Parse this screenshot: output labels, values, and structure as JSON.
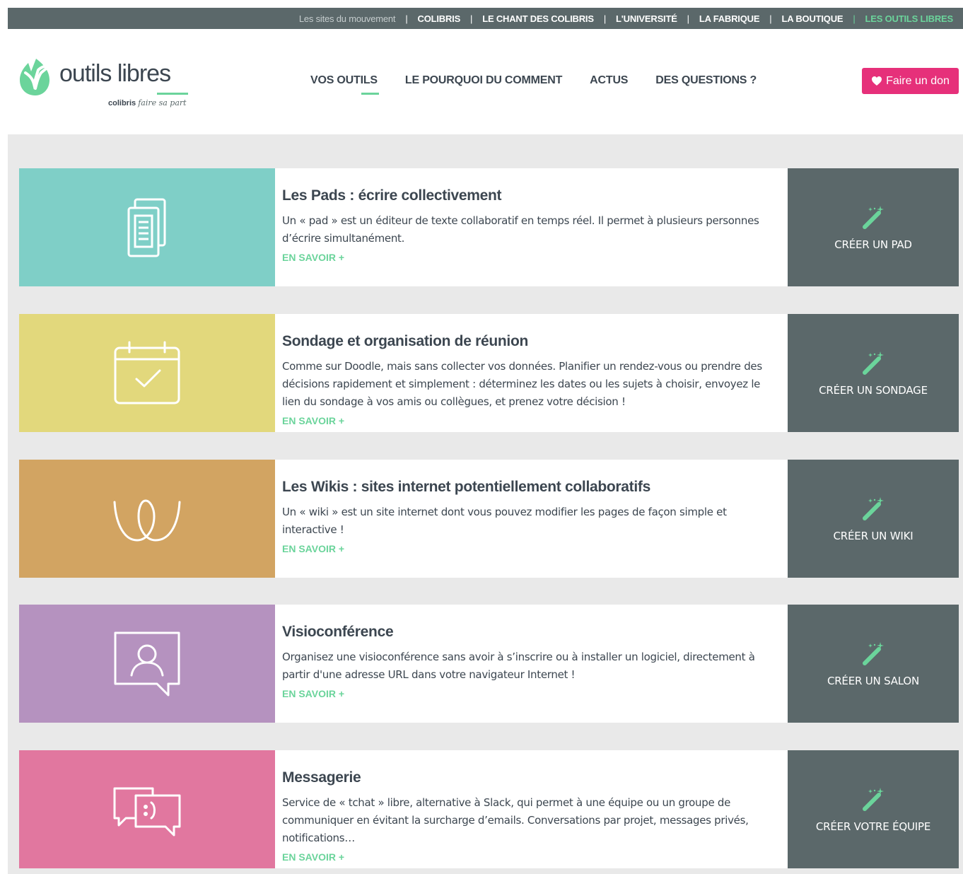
{
  "topbar": {
    "intro": "Les sites du mouvement",
    "links": [
      "COLIBRIS",
      "LE CHANT DES COLIBRIS",
      "L'UNIVERSITÉ",
      "LA FABRIQUE",
      "LA BOUTIQUE",
      "LES OUTILS LIBRES"
    ]
  },
  "header": {
    "logo_title": "outils libres",
    "logo_brand": "colibris",
    "logo_tagline": "faire sa part",
    "nav": [
      "VOS OUTILS",
      "LE POURQUOI DU COMMENT",
      "ACTUS",
      "DES QUESTIONS ?"
    ],
    "donate_label": "Faire un don"
  },
  "colors": {
    "accent": "#6bd49b",
    "donate": "#e6307a",
    "dark": "#5b686a",
    "pads": "#7fcfc7",
    "sondage": "#e2d87c",
    "wikis": "#d2a462",
    "visio": "#b592bf",
    "messagerie": "#e1779f"
  },
  "tools": [
    {
      "id": "pads",
      "icon": "document-icon",
      "title": "Les Pads : écrire collectivement",
      "description": "Un « pad » est un éditeur de texte collaboratif en temps réel. Il permet à plusieurs personnes d’écrire simultanément.",
      "more": "EN SAVOIR +",
      "action": "CRÉER UN PAD"
    },
    {
      "id": "sondage",
      "icon": "calendar-check-icon",
      "title": "Sondage et organisation de réunion",
      "description": "Comme sur Doodle, mais sans collecter vos données. Planifier un rendez-vous ou prendre des décisions rapidement et simplement : déterminez les dates ou les sujets à choisir, envoyez le lien du sondage à vos amis ou collègues, et prenez votre décision !",
      "more": "EN SAVOIR +",
      "action": "CRÉER UN SONDAGE"
    },
    {
      "id": "wikis",
      "icon": "wiki-icon",
      "title": "Les Wikis : sites internet potentiellement collaboratifs",
      "description": "Un « wiki » est un site internet dont vous pouvez modifier les pages de façon simple et interactive !",
      "more": "EN SAVOIR +",
      "action": "CRÉER UN WIKI"
    },
    {
      "id": "visio",
      "icon": "video-user-icon",
      "title": "Visioconférence",
      "description": "Organisez une visioconférence sans avoir à s’inscrire ou à installer un logiciel, directement à partir d'une adresse URL dans votre navigateur Internet !",
      "more": "EN SAVOIR +",
      "action": "CRÉER UN SALON"
    },
    {
      "id": "messagerie",
      "icon": "chat-bubbles-icon",
      "title": "Messagerie",
      "description": "Service de « tchat » libre, alternative à Slack, qui permet à une équipe ou un groupe de communiquer en évitant la surcharge d’emails. Conversations par projet, messages privés, notifications…",
      "more": "EN SAVOIR +",
      "action": "CRÉER VOTRE ÉQUIPE"
    }
  ]
}
